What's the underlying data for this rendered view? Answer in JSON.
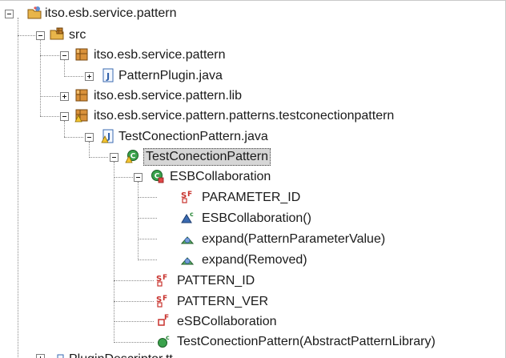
{
  "tree": {
    "project": {
      "label": "itso.esb.service.pattern",
      "icon": "java-project-icon"
    },
    "src": {
      "label": "src",
      "icon": "source-folder-icon"
    },
    "pkg_main": {
      "label": "itso.esb.service.pattern",
      "icon": "package-icon"
    },
    "pattern_plugin": {
      "label": "PatternPlugin.java",
      "icon": "java-file-icon"
    },
    "pkg_lib": {
      "label": "itso.esb.service.pattern.lib",
      "icon": "package-icon"
    },
    "pkg_patterns": {
      "label": "itso.esb.service.pattern.patterns.testconectionpattern",
      "icon": "package-warning-icon"
    },
    "file_pattern": {
      "label": "TestConectionPattern.java",
      "icon": "java-file-warning-icon"
    },
    "class_pattern": {
      "label": "TestConectionPattern",
      "icon": "class-warning-icon",
      "selected": true
    },
    "inner_class": {
      "label": "ESBCollaboration",
      "icon": "inner-class-icon"
    },
    "field_param_id": {
      "label": "PARAMETER_ID",
      "icon": "static-final-field-icon"
    },
    "ctor_collab": {
      "label": "ESBCollaboration()",
      "icon": "constructor-icon"
    },
    "method_expand_value": {
      "label": "expand(PatternParameterValue)",
      "icon": "method-icon"
    },
    "method_expand_removed": {
      "label": "expand(Removed)",
      "icon": "method-icon"
    },
    "field_pattern_id": {
      "label": "PATTERN_ID",
      "icon": "static-final-field-icon"
    },
    "field_pattern_ver": {
      "label": "PATTERN_VER",
      "icon": "static-final-field-icon"
    },
    "field_esb_collab": {
      "label": "eSBCollaboration",
      "icon": "private-field-icon"
    },
    "ctor_pattern": {
      "label": "TestConectionPattern(AbstractPatternLibrary)",
      "icon": "public-constructor-icon"
    },
    "next_item_partial": {
      "label": "PluginDescriptor.tt",
      "icon": "file-warning-icon"
    }
  },
  "colors": {
    "selection_bg": "#d6d6d6",
    "package_brown": "#b5731f",
    "class_green": "#2e8b3c",
    "field_red": "#c8322d",
    "warning_yellow": "#f4c430",
    "method_green": "#3a9a4a"
  }
}
